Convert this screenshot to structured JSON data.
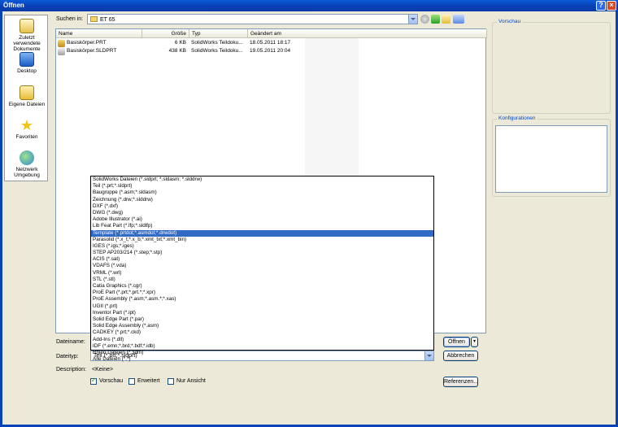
{
  "window": {
    "title": "Öffnen"
  },
  "places": [
    {
      "label": "Zuletzt verwendete Dokumente",
      "icon": "recent-documents-icon"
    },
    {
      "label": "Desktop",
      "icon": "desktop-icon"
    },
    {
      "label": "Eigene Dateien",
      "icon": "my-documents-icon"
    },
    {
      "label": "Favoriten",
      "icon": "favorites-star-icon"
    },
    {
      "label": "Netzwerk Umgebung",
      "icon": "network-icon"
    }
  ],
  "lookin": {
    "label": "Suchen in:",
    "value": "ET 65"
  },
  "columns": [
    "Name",
    "Größe",
    "Typ",
    "Geändert am"
  ],
  "files": [
    {
      "name": "Basiskörper.PRT",
      "size": "6 KB",
      "type": "SolidWorks Teildoku...",
      "modified": "18.05.2011 18:17"
    },
    {
      "name": "Basiskörper.SLDPRT",
      "size": "438 KB",
      "type": "SolidWorks Teildoku...",
      "modified": "19.05.2011 20:04"
    }
  ],
  "filetypes": [
    "SolidWorks Dateien (*.sldprt; *.sldasm; *.slddrw)",
    "Teil (*.prt;*.sldprt)",
    "Baugruppe (*.asm;*.sldasm)",
    "Zeichnung (*.drw;*.slddrw)",
    "DXF (*.dxf)",
    "DWG (*.dwg)",
    "Adobe Illustrator (*.ai)",
    "Lib Feat Part (*.lfp;*.sldlfp)",
    "Template (*.prtdot;*.asmdot;*.drwdot)",
    "Parasolid (*.x_t;*.x_b;*.xmt_txt;*.xmt_bin)",
    "IGES (*.igs;*.iges)",
    "STEP AP203/214 (*.step;*.stp)",
    "ACIS (*.sat)",
    "VDAFS (*.vda)",
    "VRML (*.wrl)",
    "STL (*.stl)",
    "Catia Graphics (*.cgr)",
    "ProE Part (*.prt;*.prt.*;*.xpr)",
    "ProE Assembly (*.asm;*.asm.*;*.xas)",
    "UGII (*.prt)",
    "Inventor Part (*.ipt)",
    "Solid Edge Part (*.par)",
    "Solid Edge Assembly (*.asm)",
    "CADKEY (*.prt;*.ckd)",
    "Add-Ins (*.dll)",
    "IDF (*.emn;*.brd;*.bdf;*.idb)",
    "Rhino Dateien (*.3dm)",
    "Alle Dateien (*.*)"
  ],
  "selected_filetype_index": 8,
  "form": {
    "filename_label": "Dateiname:",
    "filetype_label": "Dateityp:",
    "filetype_value": "Teil (*.prt;*.sldprt)",
    "description_label": "Description:",
    "description_value": "<Keine>"
  },
  "buttons": {
    "open": "Öffnen",
    "cancel": "Abbrechen",
    "references": "Referenzen..."
  },
  "checkboxes": [
    {
      "label": "Vorschau",
      "checked": true
    },
    {
      "label": "Erweitert",
      "checked": false
    },
    {
      "label": "Nur Ansicht",
      "checked": false
    }
  ],
  "panels": {
    "preview": "Vorschau",
    "configurations": "Konfigurationen"
  }
}
